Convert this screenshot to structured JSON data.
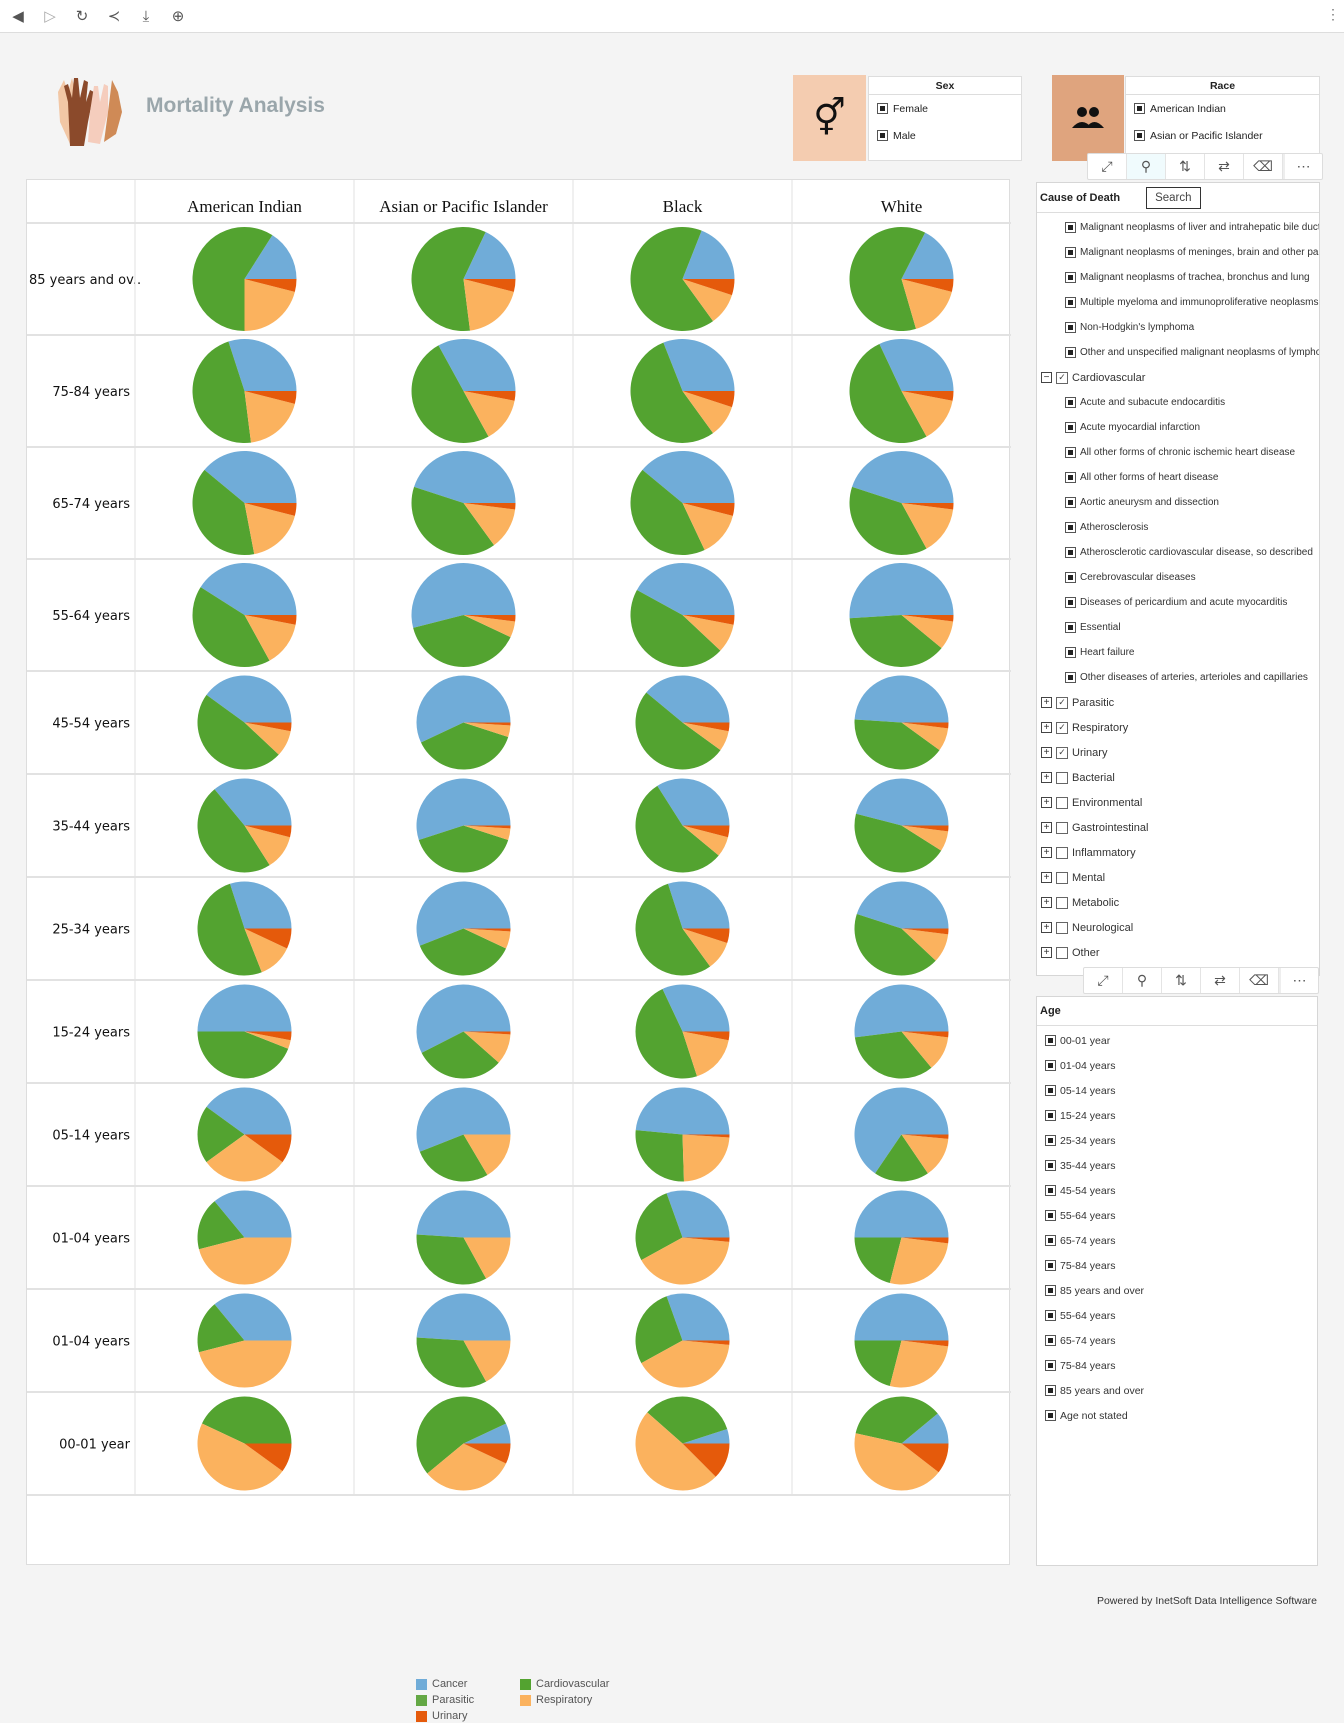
{
  "toolbar": {
    "icons": [
      "back-icon",
      "forward-icon",
      "refresh-icon",
      "share-icon",
      "download-icon",
      "zoom-in-icon"
    ]
  },
  "header": {
    "title": "Mortality Analysis"
  },
  "sex": {
    "title": "Sex",
    "options": [
      "Female",
      "Male"
    ]
  },
  "race": {
    "title": "Race",
    "options": [
      "American Indian",
      "Asian or Pacific Islander"
    ]
  },
  "cause": {
    "title": "Cause of Death",
    "search_label": "Search",
    "items": [
      {
        "label": "Malignant neoplasms of liver and intrahepatic bile duct",
        "level": 2,
        "state": "part"
      },
      {
        "label": "Malignant neoplasms of meninges, brain and other pa",
        "level": 2,
        "state": "part"
      },
      {
        "label": "Malignant neoplasms of trachea, bronchus and lung",
        "level": 2,
        "state": "part"
      },
      {
        "label": "Multiple myeloma and immunoproliferative neoplasms",
        "level": 2,
        "state": "part"
      },
      {
        "label": "Non-Hodgkin's lymphoma",
        "level": 2,
        "state": "part"
      },
      {
        "label": "Other and unspecified malignant neoplasms of lymphoi",
        "level": 2,
        "state": "part"
      },
      {
        "label": "Cardiovascular",
        "level": 1,
        "state": "check",
        "expand": "minus"
      },
      {
        "label": "Acute and subacute endocarditis",
        "level": 2,
        "state": "part"
      },
      {
        "label": "Acute myocardial infarction",
        "level": 2,
        "state": "part"
      },
      {
        "label": "All other forms of chronic ischemic heart disease",
        "level": 2,
        "state": "part"
      },
      {
        "label": "All other forms of heart disease",
        "level": 2,
        "state": "part"
      },
      {
        "label": "Aortic aneurysm and dissection",
        "level": 2,
        "state": "part"
      },
      {
        "label": "Atherosclerosis",
        "level": 2,
        "state": "part"
      },
      {
        "label": "Atherosclerotic cardiovascular disease, so described",
        "level": 2,
        "state": "part"
      },
      {
        "label": "Cerebrovascular diseases",
        "level": 2,
        "state": "part"
      },
      {
        "label": "Diseases of pericardium and acute myocarditis",
        "level": 2,
        "state": "part"
      },
      {
        "label": "Essential",
        "level": 2,
        "state": "part"
      },
      {
        "label": "Heart failure",
        "level": 2,
        "state": "part"
      },
      {
        "label": "Other diseases of arteries, arterioles and capillaries",
        "level": 2,
        "state": "part"
      },
      {
        "label": "Parasitic",
        "level": 1,
        "state": "check",
        "expand": "plus"
      },
      {
        "label": "Respiratory",
        "level": 1,
        "state": "check",
        "expand": "plus"
      },
      {
        "label": "Urinary",
        "level": 1,
        "state": "check",
        "expand": "plus"
      },
      {
        "label": "Bacterial",
        "level": 1,
        "state": "empty",
        "expand": "plus"
      },
      {
        "label": "Environmental",
        "level": 1,
        "state": "empty",
        "expand": "plus"
      },
      {
        "label": "Gastrointestinal",
        "level": 1,
        "state": "empty",
        "expand": "plus"
      },
      {
        "label": "Inflammatory",
        "level": 1,
        "state": "empty",
        "expand": "plus"
      },
      {
        "label": "Mental",
        "level": 1,
        "state": "empty",
        "expand": "plus"
      },
      {
        "label": "Metabolic",
        "level": 1,
        "state": "empty",
        "expand": "plus"
      },
      {
        "label": "Neurological",
        "level": 1,
        "state": "empty",
        "expand": "plus"
      },
      {
        "label": "Other",
        "level": 1,
        "state": "empty",
        "expand": "plus"
      }
    ]
  },
  "age": {
    "title": "Age",
    "options": [
      "00-01 year",
      "01-04 years",
      "05-14 years",
      "15-24 years",
      "25-34 years",
      "35-44 years",
      "45-54 years",
      "55-64 years",
      "65-74 years",
      "75-84 years",
      "85 years and over",
      "55-64 years",
      "65-74 years",
      "75-84 years",
      "85 years and over",
      "Age not stated"
    ]
  },
  "footer": {
    "text": "Powered by InetSoft Data Intelligence Software"
  },
  "colors": {
    "Cancer": "#70acd8",
    "Cardiovascular": "#53a330",
    "Parasitic": "#64a845",
    "Respiratory": "#fbb25e",
    "Urinary": "#e55a0b"
  },
  "chart_data": {
    "type": "pie",
    "columns": [
      "American Indian",
      "Asian or Pacific Islander",
      "Black",
      "White"
    ],
    "rows": [
      "85 years and ov..",
      "75-84 years",
      "65-74 years",
      "55-64 years",
      "45-54 years",
      "35-44 years",
      "25-34 years",
      "15-24 years",
      "05-14 years",
      "01-04 years",
      "01-04 years",
      "00-01 year"
    ],
    "series_names": [
      "Cancer",
      "Cardiovascular",
      "Parasitic",
      "Respiratory",
      "Urinary"
    ],
    "legend": [
      "Cancer",
      "Cardiovascular",
      "Parasitic",
      "Respiratory",
      "Urinary"
    ],
    "legend_position": "bottom",
    "values": [
      [
        [
          0.16,
          0.59,
          0,
          0.21,
          0.04
        ],
        [
          0.18,
          0.59,
          0,
          0.19,
          0.04
        ],
        [
          0.19,
          0.66,
          0,
          0.1,
          0.05
        ],
        [
          0.175,
          0.62,
          0,
          0.165,
          0.04
        ]
      ],
      [
        [
          0.3,
          0.47,
          0,
          0.19,
          0.04
        ],
        [
          0.33,
          0.5,
          0,
          0.14,
          0.03
        ],
        [
          0.31,
          0.54,
          0,
          0.1,
          0.05
        ],
        [
          0.32,
          0.51,
          0,
          0.14,
          0.03
        ]
      ],
      [
        [
          0.39,
          0.39,
          0,
          0.18,
          0.04
        ],
        [
          0.45,
          0.4,
          0,
          0.13,
          0.02
        ],
        [
          0.39,
          0.43,
          0,
          0.14,
          0.04
        ],
        [
          0.45,
          0.38,
          0,
          0.15,
          0.02
        ]
      ],
      [
        [
          0.41,
          0.42,
          0,
          0.14,
          0.03
        ],
        [
          0.54,
          0.39,
          0,
          0.05,
          0.02
        ],
        [
          0.42,
          0.46,
          0,
          0.09,
          0.03
        ],
        [
          0.51,
          0.38,
          0,
          0.09,
          0.02
        ]
      ],
      [
        [
          0.4,
          0.48,
          0,
          0.09,
          0.03
        ],
        [
          0.57,
          0.38,
          0,
          0.04,
          0.01
        ],
        [
          0.39,
          0.51,
          0,
          0.07,
          0.03
        ],
        [
          0.49,
          0.41,
          0,
          0.08,
          0.02
        ]
      ],
      [
        [
          0.36,
          0.48,
          0,
          0.12,
          0.04
        ],
        [
          0.55,
          0.4,
          0,
          0.04,
          0.01
        ],
        [
          0.34,
          0.55,
          0,
          0.07,
          0.04
        ],
        [
          0.46,
          0.45,
          0,
          0.07,
          0.02
        ]
      ],
      [
        [
          0.3,
          0.51,
          0,
          0.12,
          0.07
        ],
        [
          0.56,
          0.37,
          0,
          0.06,
          0.01
        ],
        [
          0.3,
          0.55,
          0,
          0.1,
          0.05
        ],
        [
          0.45,
          0.43,
          0,
          0.1,
          0.02
        ]
      ],
      [
        [
          0.5,
          0.44,
          0,
          0.03,
          0.03
        ],
        [
          0.575,
          0.31,
          0,
          0.105,
          0.01
        ],
        [
          0.32,
          0.48,
          0,
          0.17,
          0.03
        ],
        [
          0.52,
          0.34,
          0,
          0.12,
          0.02
        ]
      ],
      [
        [
          0.4,
          0.2,
          0,
          0.3,
          0.1
        ],
        [
          0.56,
          0.275,
          0,
          0.165,
          0
        ],
        [
          0.485,
          0.27,
          0,
          0.235,
          0.01
        ],
        [
          0.655,
          0.19,
          0,
          0.14,
          0.015
        ]
      ],
      [
        [
          0.36,
          0.18,
          0,
          0.46,
          0
        ],
        [
          0.49,
          0.34,
          0,
          0.17,
          0
        ],
        [
          0.305,
          0.275,
          0,
          0.405,
          0.015
        ],
        [
          0.5,
          0.21,
          0,
          0.27,
          0.02
        ]
      ],
      [
        [
          0.36,
          0.18,
          0,
          0.46,
          0
        ],
        [
          0.49,
          0.34,
          0,
          0.17,
          0
        ],
        [
          0.305,
          0.275,
          0,
          0.405,
          0.015
        ],
        [
          0.5,
          0.21,
          0,
          0.27,
          0.02
        ]
      ],
      [
        [
          0,
          0.43,
          0,
          0.47,
          0.1
        ],
        [
          0.07,
          0.54,
          0,
          0.32,
          0.07
        ],
        [
          0.05,
          0.335,
          0,
          0.49,
          0.125
        ],
        [
          0.11,
          0.355,
          0,
          0.43,
          0.105
        ]
      ]
    ]
  }
}
